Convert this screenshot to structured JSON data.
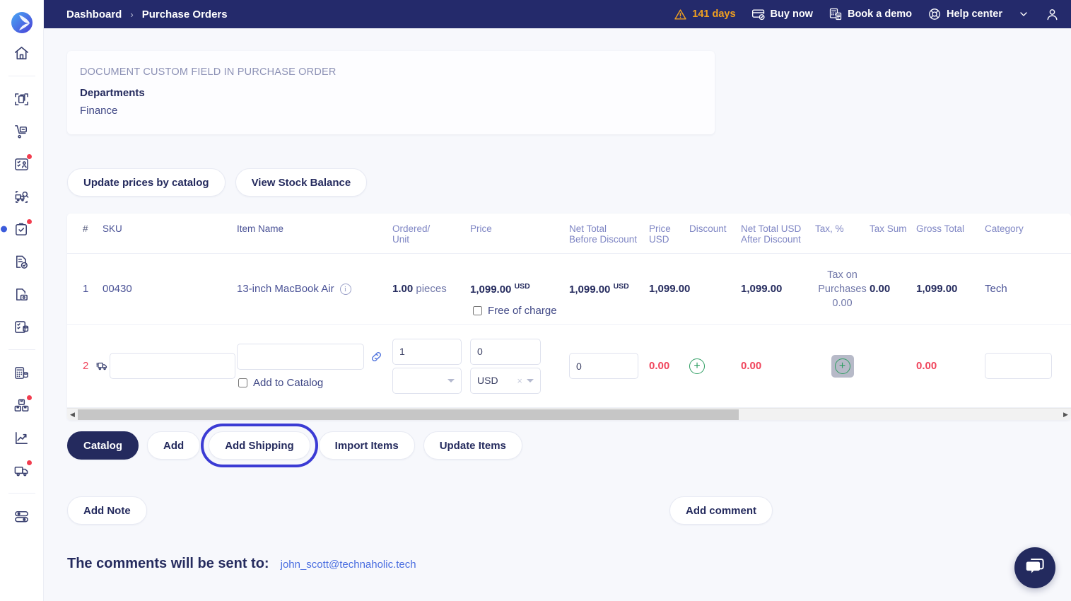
{
  "topbar": {
    "breadcrumb": [
      "Dashboard",
      "Purchase Orders"
    ],
    "chevron": "›",
    "trial_days": "141 days",
    "buy_now": "Buy now",
    "book_demo": "Book a demo",
    "help_center": "Help center"
  },
  "sidebar": {
    "items": [
      {
        "name": "home-icon",
        "badge": false
      },
      {
        "name": "documents-scan-icon",
        "badge": false
      },
      {
        "name": "delivery-cart-icon",
        "badge": false
      },
      {
        "name": "contacts-icon",
        "badge": true
      },
      {
        "name": "truck-search-icon",
        "badge": false
      },
      {
        "name": "clipboard-check-icon",
        "badge": true,
        "active": true
      },
      {
        "name": "document-approved-icon",
        "badge": false
      },
      {
        "name": "document-payment-icon",
        "badge": false
      },
      {
        "name": "inventory-records-icon",
        "badge": false
      },
      {
        "name": "calculator-icon",
        "badge": false
      },
      {
        "name": "warehouse-boxes-icon",
        "badge": true
      },
      {
        "name": "analytics-trend-icon",
        "badge": false
      },
      {
        "name": "shipping-truck-icon",
        "badge": true
      },
      {
        "name": "settings-toggles-icon",
        "badge": false
      }
    ]
  },
  "custom_field": {
    "title": "DOCUMENT CUSTOM FIELD IN PURCHASE ORDER",
    "label": "Departments",
    "value": "Finance"
  },
  "actions": {
    "update_prices": "Update prices by catalog",
    "view_stock": "View Stock Balance"
  },
  "table": {
    "headers": {
      "index": "#",
      "sku": "SKU",
      "item_name": "Item Name",
      "ordered_unit_l1": "Ordered/",
      "ordered_unit_l2": "Unit",
      "price": "Price",
      "net_total_before_l1": "Net Total",
      "net_total_before_l2": "Before Discount",
      "price_usd": "Price USD",
      "discount": "Discount",
      "net_total_after_l1": "Net Total USD",
      "net_total_after_l2": "After Discount",
      "tax_pct": "Tax, %",
      "tax_sum": "Tax Sum",
      "gross_total": "Gross Total",
      "category": "Category"
    },
    "rows": [
      {
        "index": "1",
        "sku": "00430",
        "item_name": "13-inch MacBook Air",
        "ordered_qty": "1.00",
        "unit": "pieces",
        "price": "1,099.00",
        "price_currency": "USD",
        "net_total_before": "1,099.00",
        "net_total_before_currency": "USD",
        "price_usd": "1,099.00",
        "discount": "",
        "net_total_after": "1,099.00",
        "tax_name_l1": "Tax on",
        "tax_name_l2": "Purchases",
        "tax_name_l3": "0.00",
        "tax_sum": "0.00",
        "gross_total": "1,099.00",
        "category": "Tech"
      }
    ],
    "edit_row": {
      "index": "2",
      "sku_value": "",
      "item_name_value": "",
      "add_to_catalog_label": "Add to Catalog",
      "add_to_catalog_checked": false,
      "qty_value": "1",
      "unit_value": "",
      "free_of_charge_label": "Free of charge",
      "free_of_charge_checked": false,
      "price_value": "0",
      "currency_value": "USD",
      "net_total_before_value": "0",
      "price_usd": "0.00",
      "net_total_after": "0.00",
      "gross_total": "0.00",
      "category_value": ""
    }
  },
  "tabs": [
    {
      "label": "Catalog",
      "active": true,
      "highlight": false
    },
    {
      "label": "Add",
      "active": false,
      "highlight": false
    },
    {
      "label": "Add Shipping",
      "active": false,
      "highlight": true
    },
    {
      "label": "Import Items",
      "active": false,
      "highlight": false
    },
    {
      "label": "Update Items",
      "active": false,
      "highlight": false
    }
  ],
  "bottom": {
    "add_note": "Add Note",
    "add_comment": "Add comment",
    "comments_sent_label": "The comments will be sent to:",
    "comments_email": "john_scott@technaholic.tech"
  },
  "colors": {
    "topbar_bg": "#242a6b",
    "accent_blue": "#3b3bd4",
    "warn_orange": "#f0a020",
    "danger_red": "#f0455c",
    "green": "#2f9e63"
  }
}
